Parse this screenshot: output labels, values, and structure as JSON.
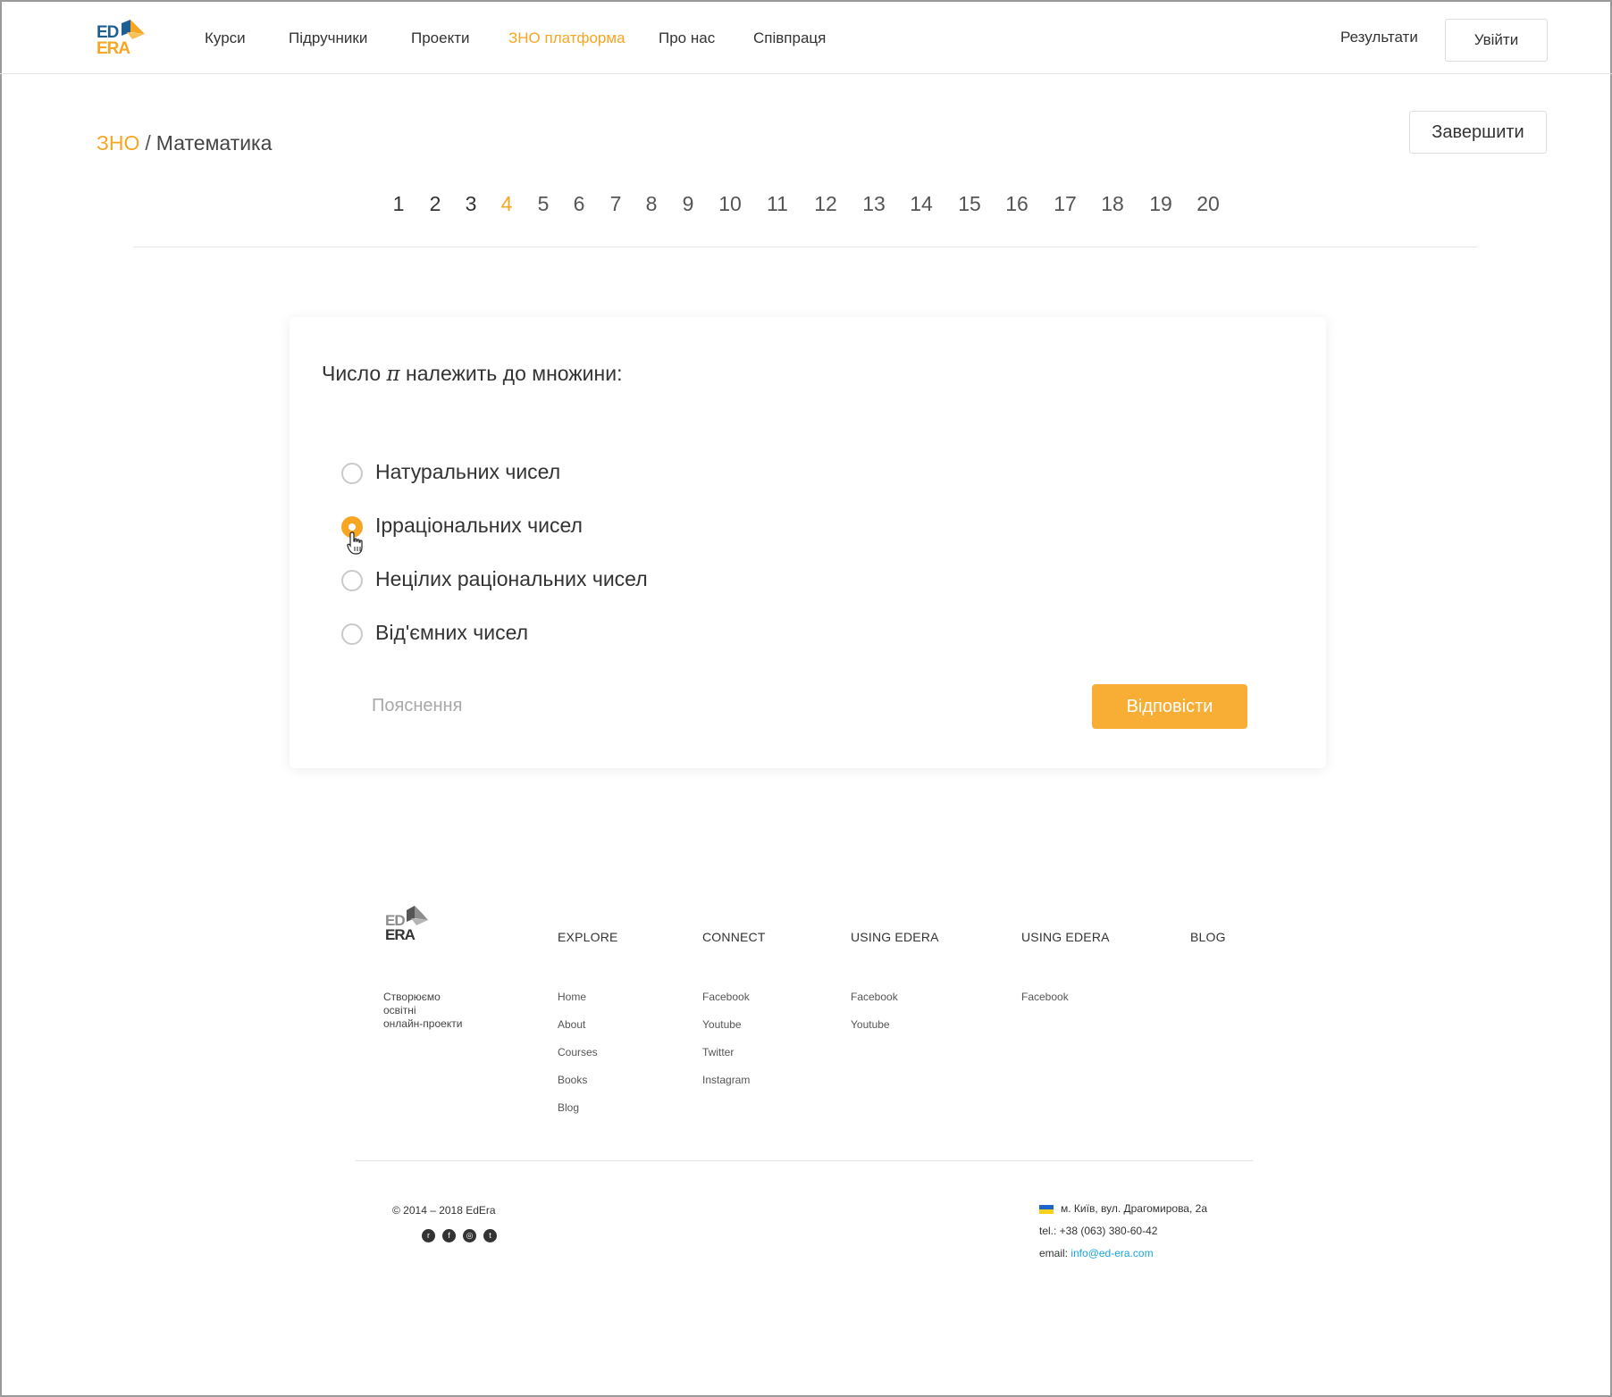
{
  "header": {
    "logo_top": "ED",
    "logo_bottom": "ERA",
    "nav": [
      {
        "label": "Курси"
      },
      {
        "label": "Підручники"
      },
      {
        "label": "Проекти"
      },
      {
        "label": "ЗНО платформа",
        "active": true
      },
      {
        "label": "Про нас"
      },
      {
        "label": "Співпраця"
      }
    ],
    "results_label": "Результати",
    "login_label": "Увійти"
  },
  "breadcrumb": {
    "root": "ЗНО",
    "separator": "/",
    "current": "Математика"
  },
  "finish_label": "Завершити",
  "question_nav": {
    "numbers": [
      "1",
      "2",
      "3",
      "4",
      "5",
      "6",
      "7",
      "8",
      "9",
      "10",
      "11",
      "12",
      "13",
      "14",
      "15",
      "16",
      "17",
      "18",
      "19",
      "20"
    ],
    "current": "4"
  },
  "question": {
    "text_before": "Число ",
    "symbol": "π",
    "text_after": " належить до множини:",
    "options": [
      {
        "label": "Натуральних чисел",
        "selected": false
      },
      {
        "label": "Ірраціональних чисел",
        "selected": true
      },
      {
        "label": "Нецілих раціональних чисел",
        "selected": false
      },
      {
        "label": "Від'ємних чисел",
        "selected": false
      }
    ],
    "explain_label": "Пояснення",
    "answer_label": "Відповісти"
  },
  "footer": {
    "logo_top": "ED",
    "logo_bottom": "ERA",
    "tagline": [
      "Створюємо",
      "освітні",
      "онлайн-проекти"
    ],
    "columns": [
      {
        "title": "EXPLORE",
        "items": [
          "Home",
          "About",
          "Courses",
          "Books",
          "Blog"
        ]
      },
      {
        "title": "CONNECT",
        "items": [
          "Facebook",
          "Youtube",
          "Twitter",
          "Instagram"
        ]
      },
      {
        "title": "USING EDERA",
        "items": [
          "Facebook",
          "Youtube"
        ]
      },
      {
        "title": "USING EDERA",
        "items": [
          "Facebook"
        ]
      },
      {
        "title": "BLOG",
        "items": []
      }
    ],
    "copyright": "© 2014 – 2018  EdEra",
    "social_icons": [
      "reddit-icon",
      "facebook-icon",
      "instagram-icon",
      "twitter-icon"
    ],
    "address": "м. Київ, вул. Драгомирова, 2а",
    "phone": "tel.: +38 (063) 380-60-42",
    "email_prefix": "email: ",
    "email": "info@ed-era.com"
  },
  "colors": {
    "accent": "#f6a623",
    "answer_button": "#f8ae34",
    "link_blue": "#1aa5d8",
    "brand_blue": "#1f5e93"
  }
}
